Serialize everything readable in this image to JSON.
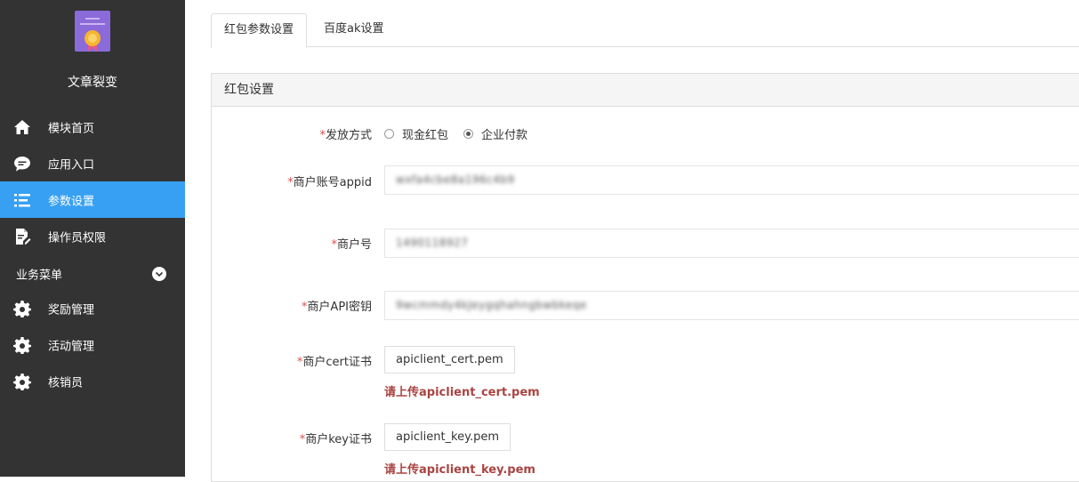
{
  "sidebar": {
    "app_title": "文章裂变",
    "items": [
      {
        "label": "模块首页",
        "icon": "home-icon"
      },
      {
        "label": "应用入口",
        "icon": "chat-bubble-icon"
      },
      {
        "label": "参数设置",
        "icon": "list-icon"
      },
      {
        "label": "操作员权限",
        "icon": "document-edit-icon"
      }
    ],
    "section": {
      "label": "业务菜单",
      "icon": "chevron-down-icon"
    },
    "section_items": [
      {
        "label": "奖励管理",
        "icon": "gear-icon"
      },
      {
        "label": "活动管理",
        "icon": "gear-icon"
      },
      {
        "label": "核销员",
        "icon": "gear-icon"
      }
    ],
    "active_index": 2,
    "active_color": "#38a0f2"
  },
  "tabs": [
    {
      "label": "红包参数设置",
      "active": true
    },
    {
      "label": "百度ak设置",
      "active": false
    }
  ],
  "panel": {
    "title": "红包设置",
    "required_mark": "*",
    "pay_method": {
      "label": "发放方式",
      "options": [
        {
          "label": "现金红包",
          "checked": false
        },
        {
          "label": "企业付款",
          "checked": true
        }
      ]
    },
    "appid": {
      "label": "商户账号appid",
      "value": "wxfa4cbe8a196c4b9"
    },
    "mch_id": {
      "label": "商户号",
      "value": "1490118927"
    },
    "api_key": {
      "label": "商户API密钥",
      "value": "9wcmmdy4kJeygqhahngbwbkeqe"
    },
    "cert": {
      "label": "商户cert证书",
      "file": "apiclient_cert.pem",
      "hint": "请上传apiclient_cert.pem"
    },
    "key": {
      "label": "商户key证书",
      "file": "apiclient_key.pem",
      "hint": "请上传apiclient_key.pem"
    }
  }
}
